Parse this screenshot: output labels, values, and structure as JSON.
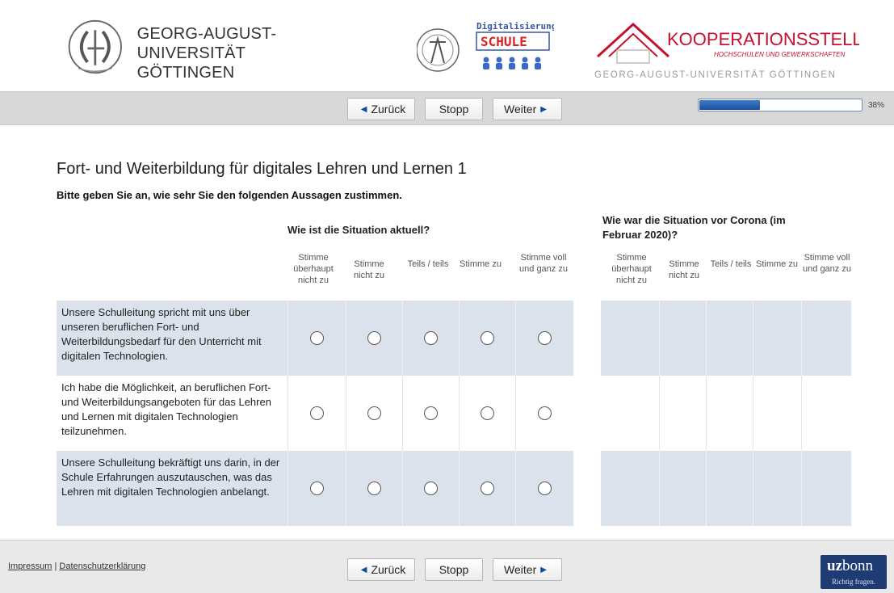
{
  "header": {
    "university_line1": "GEORG-AUGUST-UNIVERSITÄT",
    "university_line2": "GÖTTINGEN",
    "digi_title": "Digitalisierung",
    "digi_word": "SCHULE",
    "koop_title": "KOOPERATIONSSTELLE",
    "koop_sub": "HOCHSCHULEN UND GEWERKSCHAFTEN",
    "koop_line": "GEORG-AUGUST-UNIVERSITÄT GÖTTINGEN"
  },
  "nav": {
    "back_label": "Zurück",
    "stop_label": "Stopp",
    "next_label": "Weiter",
    "progress_percent": 38,
    "progress_label": "38%"
  },
  "survey": {
    "title": "Fort- und Weiterbildung für digitales Lehren und Lernen 1",
    "instruction": "Bitte geben Sie an, wie sehr Sie den folgenden Aussagen zustimmen.",
    "group_current": "Wie ist die Situation aktuell?",
    "group_before": "Wie war die Situation vor Corona (im Februar 2020)?",
    "scale": [
      "Stimme überhaupt nicht zu",
      "Stimme nicht zu",
      "Teils / teils",
      "Stimme zu",
      "Stimme voll und ganz zu"
    ],
    "items": [
      "Unsere Schulleitung spricht mit uns über unseren beruflichen Fort- und Weiterbildungsbedarf für den Unterricht mit digitalen Technologien.",
      "Ich habe die Möglichkeit, an beruflichen Fort- und Weiterbildungsangeboten für das Lehren und Lernen mit digitalen Technologien teilzunehmen.",
      "Unsere Schulleitung bekräftigt uns darin, in der Schule Erfahrungen auszutauschen, was das Lehren mit digitalen Technologien anbelangt."
    ]
  },
  "footer": {
    "impressum": "Impressum",
    "separator": "|",
    "datenschutz": "Datenschutzerklärung",
    "brand_uz": "uz",
    "brand_bonn": "bonn",
    "brand_tagline": "Richtig fragen."
  },
  "colors": {
    "row_shade": "#dce2ec",
    "progress": "#1b4f9a",
    "koop_red": "#c8102e"
  }
}
